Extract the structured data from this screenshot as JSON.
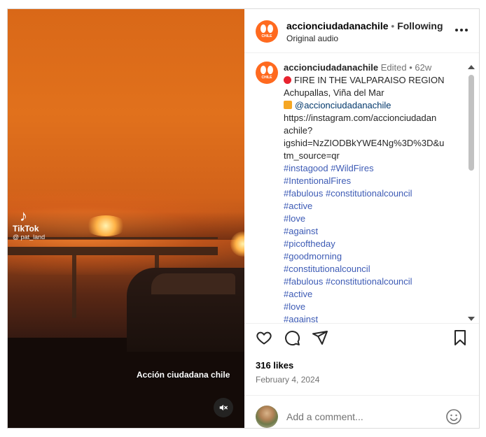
{
  "video": {
    "tiktok_label": "TikTok",
    "tiktok_user": "@ pat_land",
    "watermark": "Acción ciudadana chile",
    "mute_icon": "speaker-muted-icon"
  },
  "header": {
    "username": "accionciudadanachile",
    "separator": "•",
    "follow_status": "Following",
    "audio": "Original audio",
    "more_icon": "more-horizontal-icon"
  },
  "caption": {
    "username": "accionciudadanachile",
    "edited": "Edited",
    "separator": "•",
    "age": "62w",
    "headline": "FIRE IN THE VALPARAISO REGION",
    "location": "Achupallas, Viña del Mar",
    "mention": "@accionciudadanachile",
    "url_lines": [
      "https://instagram.com/accionciudadan",
      "achile?",
      "igshid=NzZIODBkYWE4Ng%3D%3D&u",
      "tm_source=qr"
    ],
    "tag_lines": [
      "#instagood #WildFires",
      "#IntentionalFires",
      "#fabulous #constitutionalcouncil",
      "#active",
      "#love",
      "#against",
      "#picoftheday",
      "#goodmorning",
      "#constitutionalcouncil",
      "#fabulous #constitutionalcouncil",
      "#active",
      "#love",
      "#against"
    ]
  },
  "actions": {
    "likes": "316 likes",
    "date": "February 4, 2024",
    "comment_placeholder": "Add a comment..."
  },
  "colors": {
    "accent_avatar": "#ff6a1f",
    "link": "#00376b",
    "hashtag": "#3d5bb5",
    "muted_text": "#737373"
  }
}
